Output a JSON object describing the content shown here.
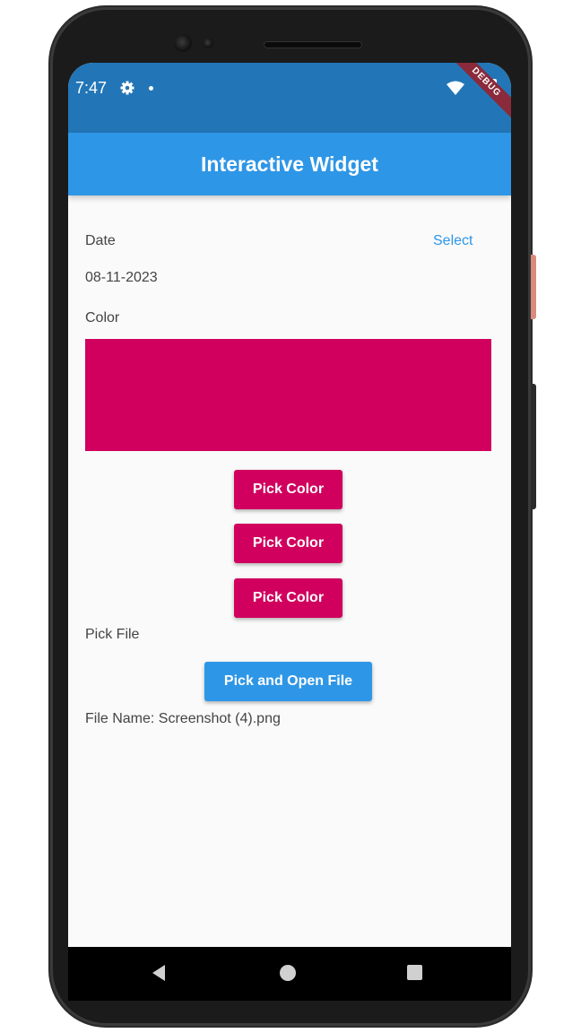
{
  "status_bar": {
    "time": "7:47",
    "debug_banner": "DEBUG"
  },
  "app_bar": {
    "title": "Interactive Widget"
  },
  "date_section": {
    "label": "Date",
    "select_label": "Select",
    "value": "08-11-2023"
  },
  "color_section": {
    "label": "Color",
    "selected_color": "#d1005e",
    "buttons": [
      "Pick Color",
      "Pick Color",
      "Pick Color"
    ]
  },
  "file_section": {
    "label": "Pick File",
    "button_label": "Pick and Open File",
    "file_name_text": "File Name: Screenshot (4).png"
  },
  "theme": {
    "status_bar_color": "#2276b7",
    "app_bar_color": "#2e96e6",
    "accent_color": "#2e96e6",
    "pick_button_color": "#d1005e"
  },
  "nav_bar": {
    "icons": [
      "back-icon",
      "home-icon",
      "recents-icon"
    ]
  }
}
